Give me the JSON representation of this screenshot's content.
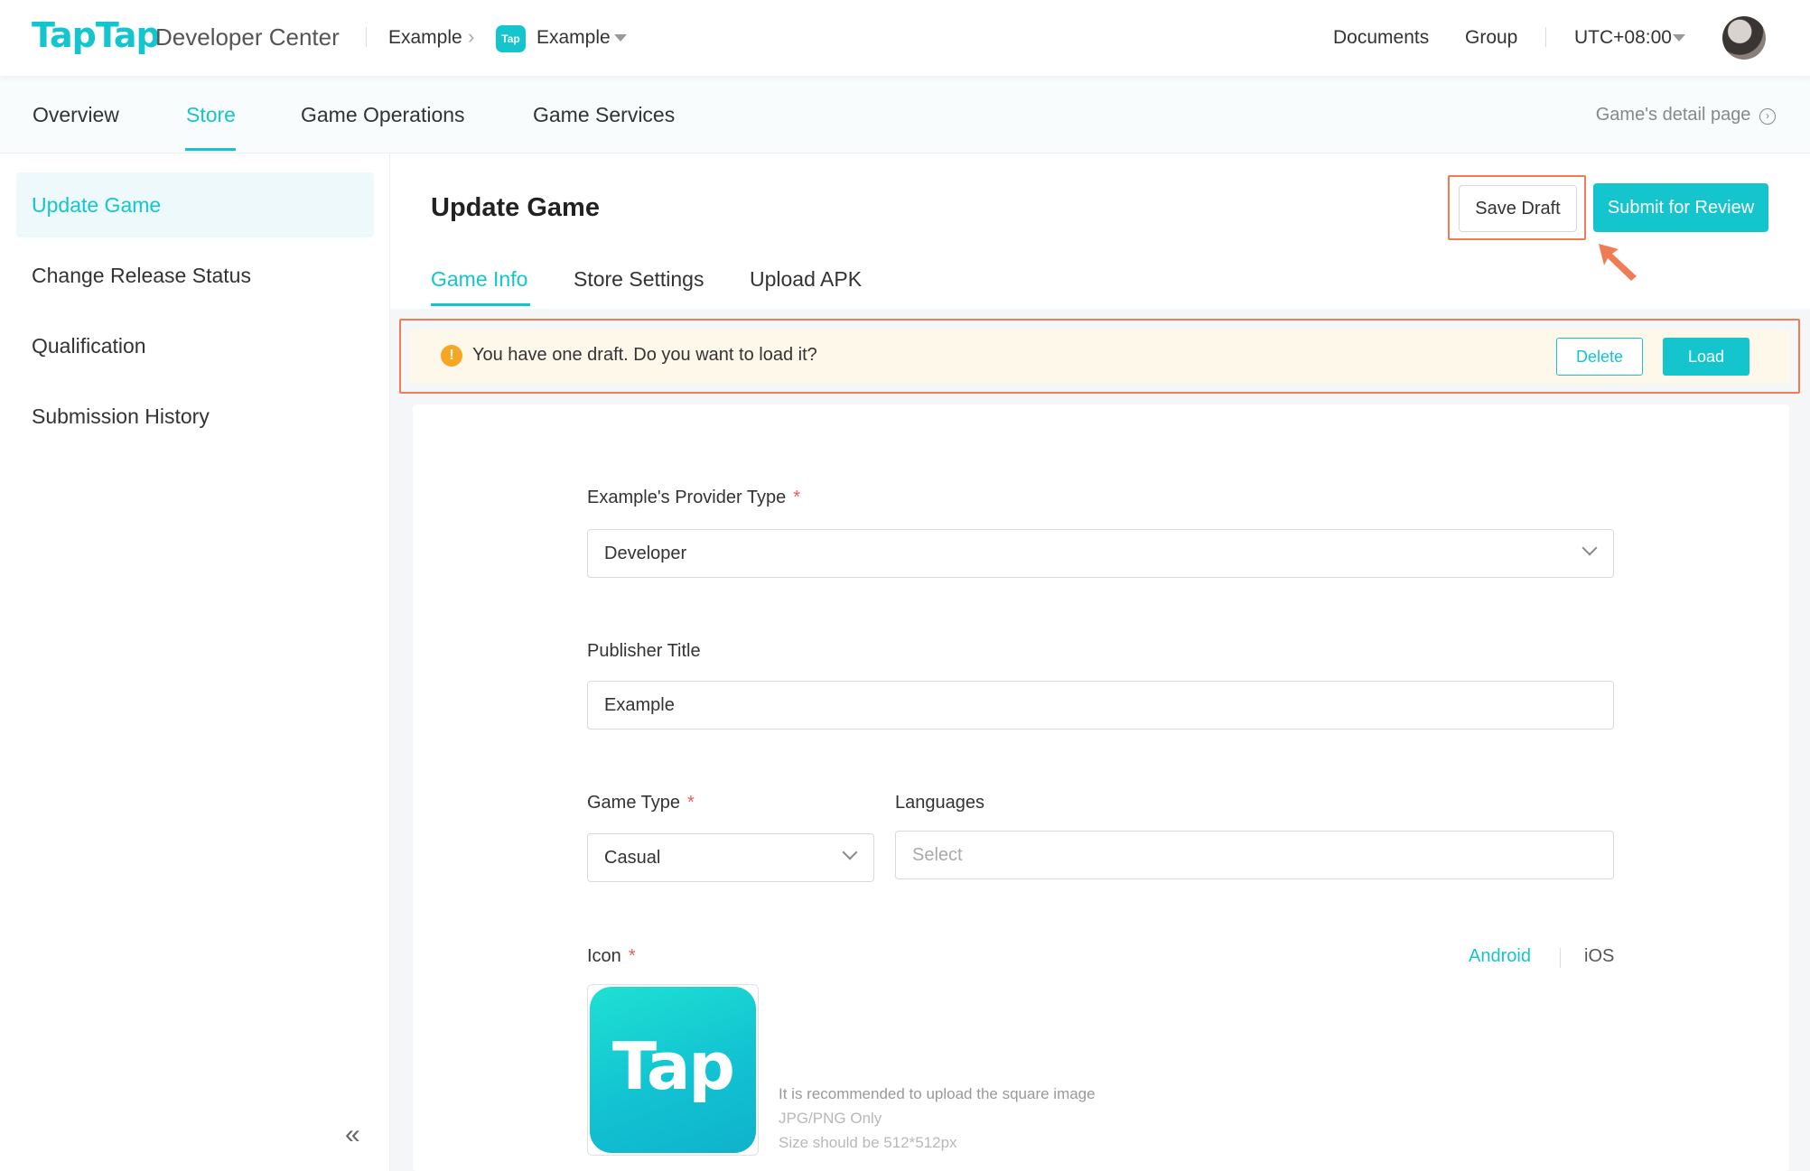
{
  "header": {
    "logo": "TapTap",
    "product": "Developer Center",
    "breadcrumb_org": "Example",
    "app_badge": "Tap",
    "breadcrumb_app": "Example",
    "links": [
      "Documents",
      "Group"
    ],
    "timezone": "UTC+08:00"
  },
  "nav": {
    "items": [
      "Overview",
      "Store",
      "Game Operations",
      "Game Services"
    ],
    "active": "Store",
    "detail_link": "Game's detail page"
  },
  "sidebar": {
    "items": [
      "Update Game",
      "Change Release Status",
      "Qualification",
      "Submission History"
    ],
    "active": "Update Game"
  },
  "page": {
    "title": "Update Game",
    "save_draft": "Save Draft",
    "submit": "Submit for Review",
    "tabs": [
      "Game Info",
      "Store Settings",
      "Upload APK"
    ],
    "active_tab": "Game Info"
  },
  "notice": {
    "text": "You have one draft. Do you want to load it?",
    "delete": "Delete",
    "load": "Load"
  },
  "form": {
    "provider_type_label": "Example's Provider Type",
    "provider_type_value": "Developer",
    "publisher_title_label": "Publisher Title",
    "publisher_title_value": "Example",
    "game_type_label": "Game Type",
    "game_type_value": "Casual",
    "languages_label": "Languages",
    "languages_placeholder": "Select",
    "icon_label": "Icon",
    "platform_android": "Android",
    "platform_ios": "iOS",
    "icon_text": "Tap",
    "hint_1": "It is recommended to upload the square image",
    "hint_2": "JPG/PNG Only",
    "hint_3": "Size should be 512*512px",
    "required_mark": "*"
  },
  "colors": {
    "accent": "#15c5ce",
    "highlight": "#f07c55",
    "warning": "#f5a623",
    "notice_bg": "#fef8ea"
  }
}
